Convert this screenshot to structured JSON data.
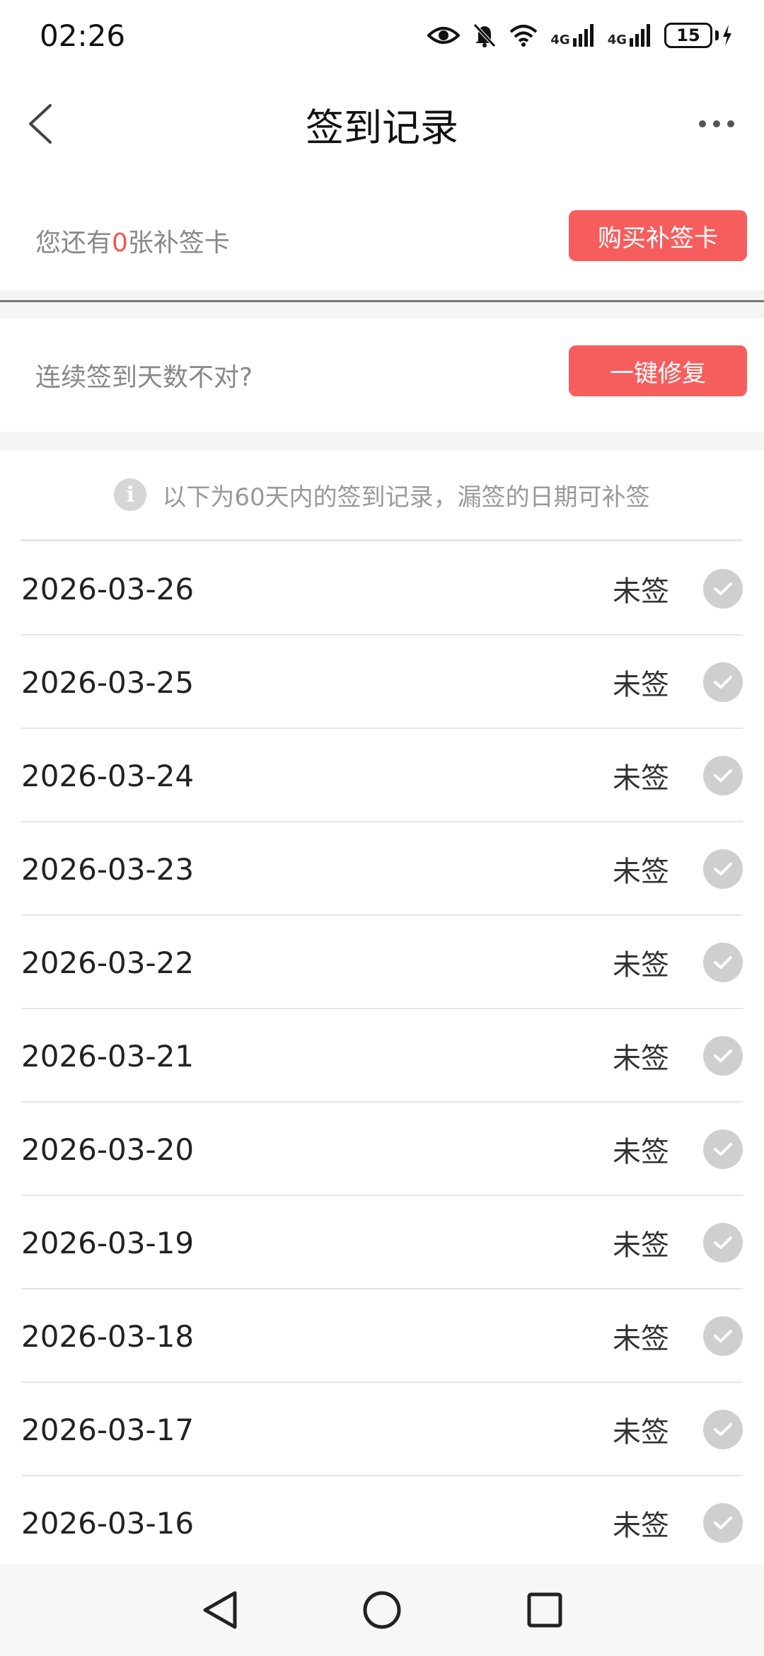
{
  "status_bar": {
    "time": "02:26",
    "signal1_label": "4G",
    "signal2_label": "4G",
    "battery_level": "15"
  },
  "header": {
    "title": "签到记录"
  },
  "card_section": {
    "prefix": "您还有",
    "count": "0",
    "suffix": "张补签卡",
    "buy_button": "购买补签卡"
  },
  "repair_section": {
    "label": "连续签到天数不对?",
    "repair_button": "一键修复"
  },
  "notice": {
    "icon_glyph": "i",
    "text": "以下为60天内的签到记录，漏签的日期可补签"
  },
  "records": [
    {
      "date": "2026-03-26",
      "status": "未签"
    },
    {
      "date": "2026-03-25",
      "status": "未签"
    },
    {
      "date": "2026-03-24",
      "status": "未签"
    },
    {
      "date": "2026-03-23",
      "status": "未签"
    },
    {
      "date": "2026-03-22",
      "status": "未签"
    },
    {
      "date": "2026-03-21",
      "status": "未签"
    },
    {
      "date": "2026-03-20",
      "status": "未签"
    },
    {
      "date": "2026-03-19",
      "status": "未签"
    },
    {
      "date": "2026-03-18",
      "status": "未签"
    },
    {
      "date": "2026-03-17",
      "status": "未签"
    },
    {
      "date": "2026-03-16",
      "status": "未签"
    }
  ],
  "colors": {
    "accent_red": "#f65e5e",
    "check_grey": "#cfcfcf"
  }
}
